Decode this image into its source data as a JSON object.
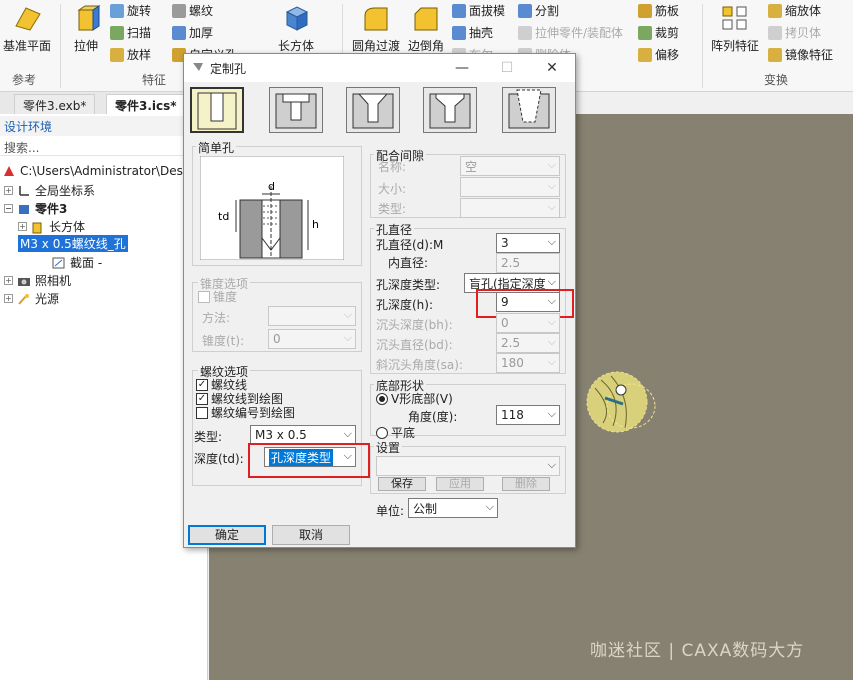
{
  "ribbon": {
    "datum_plane": "基准平面",
    "extrude": "拉伸",
    "revolve": "旋转",
    "sweep": "扫描",
    "loft": "放样",
    "thread": "螺纹",
    "thicken": "加厚",
    "custom_hole_partial": "自定义孔",
    "box": "长方体",
    "fillet": "圆角过渡",
    "chamfer": "边倒角",
    "draft": "面拔模",
    "shell": "抽壳",
    "hide_partial": "布尔",
    "split": "分割",
    "split_part": "拉伸零件/装配体",
    "delete_partial": "删除体",
    "rib": "筋板",
    "trim": "裁剪",
    "offset": "偏移",
    "pattern": "阵列特征",
    "scale": "缩放体",
    "copy": "拷贝体",
    "mirror": "镜像特征",
    "group_reference": "参考",
    "group_feature": "特征",
    "group_transform": "变换"
  },
  "tabs": [
    "零件3.exb*",
    "零件3.ics*"
  ],
  "left_pane": {
    "design_env": "设计环境",
    "search_placeholder": "搜索...",
    "tree": {
      "path": "C:\\Users\\Administrator\\Desk",
      "global_coords": "全局坐标系",
      "part": "零件3",
      "box": "长方体",
      "hole": "M3 x 0.5螺纹线_孔",
      "section": "截面 -",
      "camera": "照相机",
      "light": "光源"
    }
  },
  "dialog": {
    "title": "定制孔",
    "simple_hole": "简单孔",
    "taper_options": "锥度选项",
    "taper_checkbox": "锥度",
    "method_label": "方法:",
    "taper_t_label": "锥度(t):",
    "taper_t_value": "0",
    "thread_options": "螺纹选项",
    "thread_cb1": "螺纹线",
    "thread_cb2": "螺纹线到绘图",
    "thread_cb3": "螺纹编号到绘图",
    "type_label": "类型:",
    "type_value": "M3 x 0.5",
    "depth_label": "深度(td):",
    "depth_value": "孔深度类型",
    "fit_clearance": "配合间隙",
    "name_label": "名称:",
    "name_value": "空",
    "size_label": "大小:",
    "kind_label": "类型:",
    "hole_diameter_group": "孔直径",
    "hole_d_label": "孔直径(d):M",
    "hole_d_value": "3",
    "inner_d_label": "内直径:",
    "inner_d_value": "2.5",
    "depth_type_label": "孔深度类型:",
    "depth_type_value": "盲孔(指定深度",
    "hole_h_label": "孔深度(h):",
    "hole_h_value": "9",
    "cb_depth_label": "沉头深度(bh):",
    "cb_depth_value": "0",
    "cb_d_label": "沉头直径(bd):",
    "cb_d_value": "2.5",
    "cs_angle_label": "斜沉头角度(sa):",
    "cs_angle_value": "180",
    "bottom_shape": "底部形状",
    "v_bottom": "V形底部(V)",
    "angle_label": "角度(度):",
    "angle_value": "118",
    "flat_bottom": "平底",
    "settings": "设置",
    "save": "保存",
    "apply": "应用",
    "delete": "删除",
    "unit_label": "单位:",
    "unit_value": "公制",
    "ok": "确定",
    "cancel": "取消",
    "diagram_labels": {
      "d": "d",
      "td": "td",
      "h": "h"
    }
  },
  "watermark": "咖迷社区 | CAXA数码大方"
}
